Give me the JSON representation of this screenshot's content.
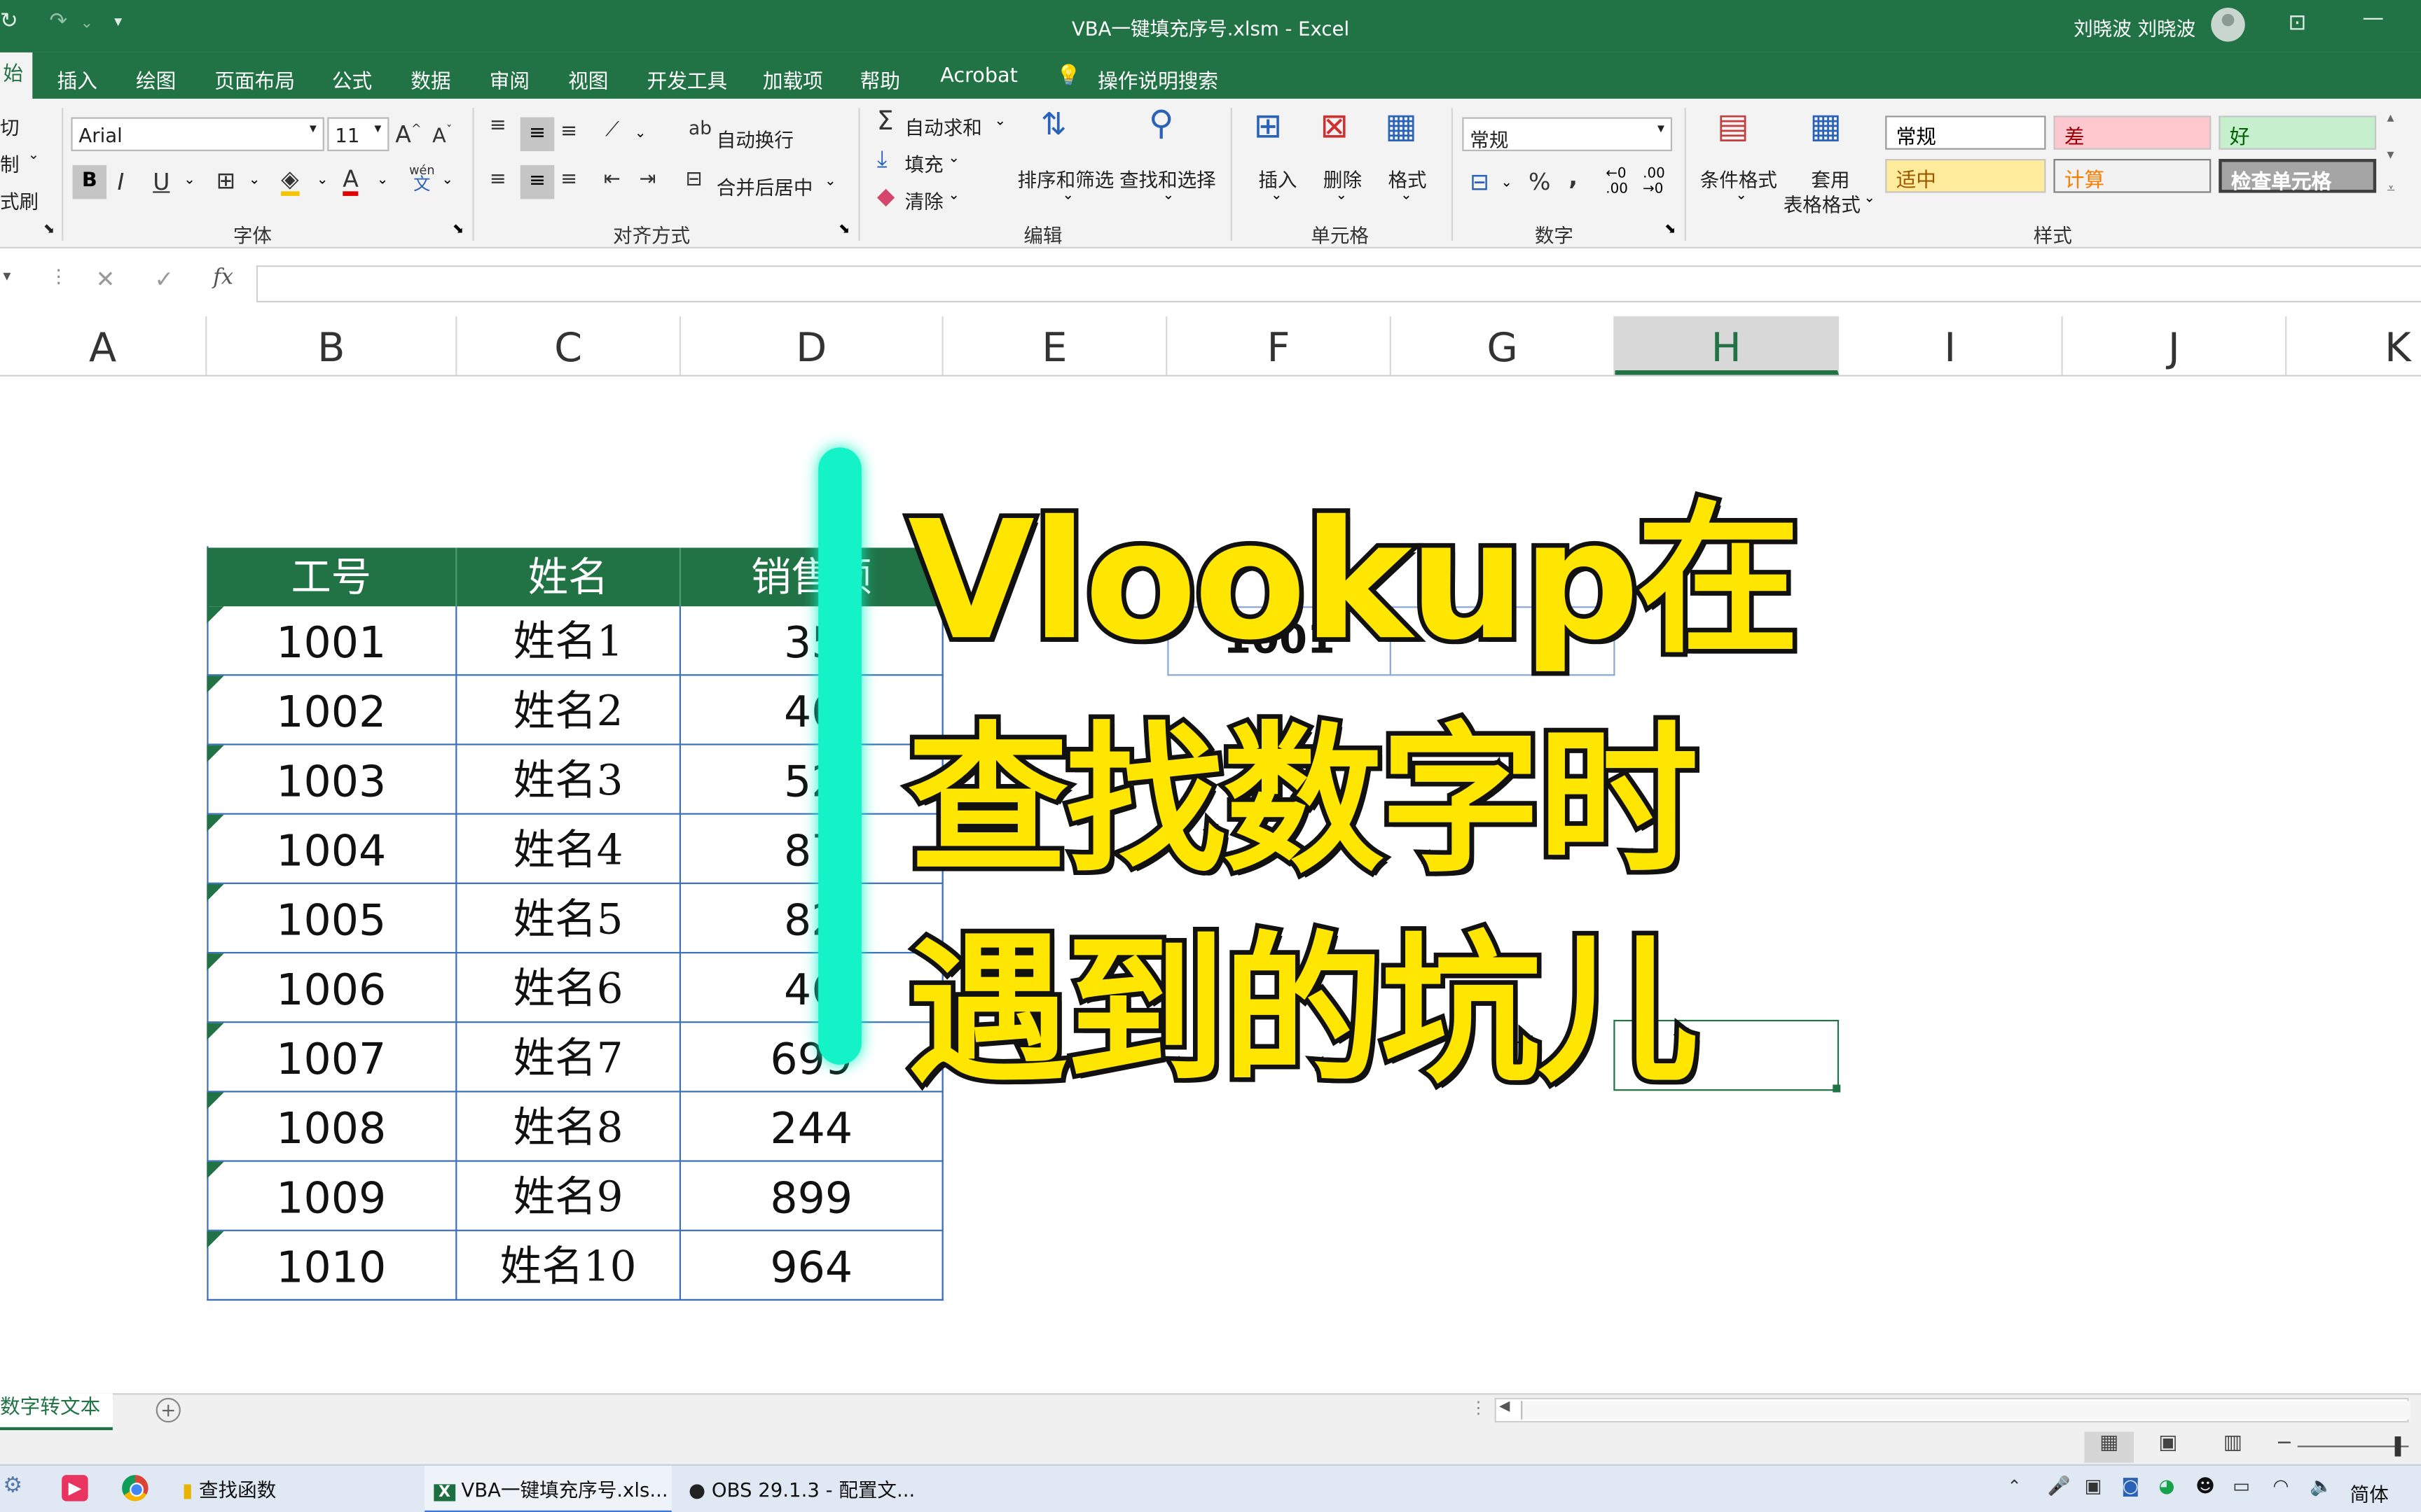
{
  "window": {
    "title": "VBA一键填充序号.xlsm - Excel",
    "user": "刘晓波 刘晓波"
  },
  "ribbon_tabs": [
    {
      "label": "开始",
      "visible": "始",
      "active": true
    },
    {
      "label": "插入"
    },
    {
      "label": "绘图"
    },
    {
      "label": "页面布局"
    },
    {
      "label": "公式"
    },
    {
      "label": "数据"
    },
    {
      "label": "审阅"
    },
    {
      "label": "视图"
    },
    {
      "label": "开发工具"
    },
    {
      "label": "加载项"
    },
    {
      "label": "帮助"
    },
    {
      "label": "Acrobat"
    }
  ],
  "tell_me": "操作说明搜索",
  "clipboard": {
    "cut": "切",
    "copy": "制",
    "painter": "式刷"
  },
  "font": {
    "name": "Arial",
    "size": "11",
    "group": "字体",
    "bold": "B",
    "italic": "I",
    "underline": "U",
    "wen": "wén",
    "wen2": "文"
  },
  "alignment": {
    "wrap": "自动换行",
    "merge": "合并后居中",
    "group": "对齐方式"
  },
  "editing": {
    "autosum": "自动求和",
    "fill": "填充",
    "clear": "清除",
    "sort": "排序和筛选",
    "find": "查找和选择",
    "group": "编辑"
  },
  "cells": {
    "insert": "插入",
    "delete": "删除",
    "format": "格式",
    "group": "单元格"
  },
  "number": {
    "format": "常规",
    "percent": "%",
    "comma": ",",
    "group": "数字",
    "inc": "←0 .00",
    "dec": ".00 →0"
  },
  "styles": {
    "conditional": "条件格式",
    "table_line1": "套用",
    "table_line2": "表格格式",
    "normal": "常规",
    "bad": "差",
    "good": "好",
    "neutral": "适中",
    "calc": "计算",
    "check": "检查单元格",
    "group": "样式"
  },
  "formula_bar": {
    "cancel": "✕",
    "enter": "✓",
    "fx": "fx",
    "content": ""
  },
  "columns": [
    "A",
    "B",
    "C",
    "D",
    "E",
    "F",
    "G",
    "H",
    "I",
    "J",
    "K"
  ],
  "selected_column": "H",
  "table": {
    "headers": [
      "工号",
      "姓名",
      "销售额"
    ],
    "rows": [
      [
        "1001",
        "姓名1",
        "35"
      ],
      [
        "1002",
        "姓名2",
        "40"
      ],
      [
        "1003",
        "姓名3",
        "52"
      ],
      [
        "1004",
        "姓名4",
        "87"
      ],
      [
        "1005",
        "姓名5",
        "82"
      ],
      [
        "1006",
        "姓名6",
        "46"
      ],
      [
        "1007",
        "姓名7",
        "699"
      ],
      [
        "1008",
        "姓名8",
        "244"
      ],
      [
        "1009",
        "姓名9",
        "899"
      ],
      [
        "1010",
        "姓名10",
        "964"
      ]
    ]
  },
  "lookup_cell": "1001",
  "overlay_title": [
    "Vlookup在",
    "查找数字时",
    "遇到的坑儿"
  ],
  "sheet_tab": "数字转文本",
  "taskbar": {
    "item1": "查找函数",
    "item2": "VBA一键填充序号.xls...",
    "item3": "OBS 29.1.3 - 配置文...",
    "ime": "简体"
  },
  "colors": {
    "excel_green": "#217346",
    "highlight": "#ffe600",
    "bar": "#14f2c8"
  }
}
